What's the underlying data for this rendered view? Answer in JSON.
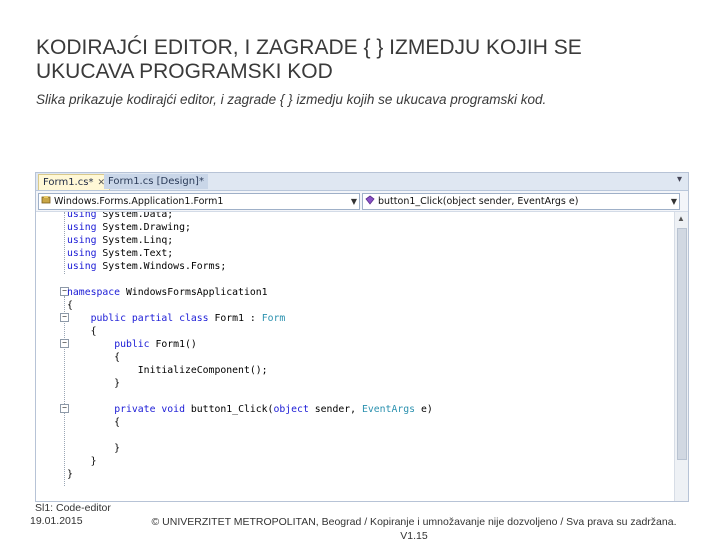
{
  "slide": {
    "title_line1": "KODIRAJĆI EDITOR, I ZAGRADE {   } IZMEDJU KOJIH SE",
    "title_line2": "UKUCAVA PROGRAMSKI KOD",
    "subtitle": "Slika prikazuje kodirajći editor, i zagrade {   } izmedju kojih se ukucava programski kod."
  },
  "ide": {
    "tabs": [
      {
        "label": "Form1.cs*",
        "active": true
      },
      {
        "label": "Form1.cs [Design]*",
        "active": false
      }
    ],
    "nav_left": "Windows.Forms.Application1.Form1",
    "nav_right": "button1_Click(object sender, EventArgs e)",
    "code_lines": [
      "using System.Data;",
      "using System.Drawing;",
      "using System.Linq;",
      "using System.Text;",
      "using System.Windows.Forms;",
      "",
      "namespace WindowsFormsApplication1",
      "{",
      "    public partial class Form1 : Form",
      "    {",
      "        public Form1()",
      "        {",
      "            InitializeComponent();",
      "        }",
      "",
      "        private void button1_Click(object sender, EventArgs e)",
      "        {",
      "",
      "        }",
      "    }",
      "}"
    ]
  },
  "footer": {
    "label": "Sl1: Code-editor",
    "date": "19.01.2015",
    "copyright": "© UNIVERZITET METROPOLITAN, Beograd / Kopiranje i umnožavanje nije dozvoljeno / Sva prava su zadržana.",
    "version": "V1.15"
  }
}
